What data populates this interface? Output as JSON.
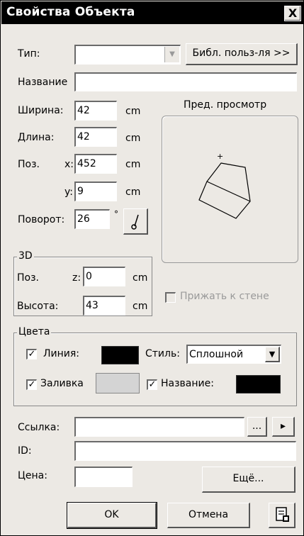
{
  "window": {
    "title": "Свойства Объекта",
    "close_label": "X"
  },
  "type": {
    "label": "Тип:",
    "value": "",
    "library_button": "Библ. польз-ля >>"
  },
  "name": {
    "label": "Название",
    "value": ""
  },
  "width": {
    "label": "Ширина:",
    "value": "42",
    "unit": "cm"
  },
  "length": {
    "label": "Длина:",
    "value": "42",
    "unit": "cm"
  },
  "pos": {
    "label": "Поз.",
    "x_label": "x:",
    "x_value": "452",
    "x_unit": "cm",
    "y_label": "y:",
    "y_value": "9",
    "y_unit": "cm"
  },
  "rotation": {
    "label": "Поворот:",
    "value": "26",
    "unit": "°"
  },
  "preview": {
    "label": "Пред. просмотр"
  },
  "group3d": {
    "legend": "3D",
    "pos_label": "Поз.",
    "z_label": "z:",
    "z_value": "0",
    "z_unit": "cm",
    "height_label": "Высота:",
    "height_value": "43",
    "height_unit": "cm"
  },
  "snap_to_wall": {
    "label": "Прижать к стене",
    "checked": false,
    "enabled": false
  },
  "colors": {
    "legend": "Цвета",
    "line": {
      "label": "Линия:",
      "checked": true,
      "color": "#000000"
    },
    "style": {
      "label": "Стиль:",
      "value": "Сплошной"
    },
    "fill": {
      "label": "Заливка",
      "checked": true,
      "color": "#d4d4d4"
    },
    "name": {
      "label": "Название:",
      "checked": true,
      "color": "#000000"
    }
  },
  "link": {
    "label": "Ссылка:",
    "value": "",
    "browse": "...",
    "go": "▸"
  },
  "id": {
    "label": "ID:",
    "value": ""
  },
  "price": {
    "label": "Цена:",
    "value": "",
    "more_button": "Ещё..."
  },
  "footer": {
    "ok": "OK",
    "cancel": "Отмена"
  }
}
